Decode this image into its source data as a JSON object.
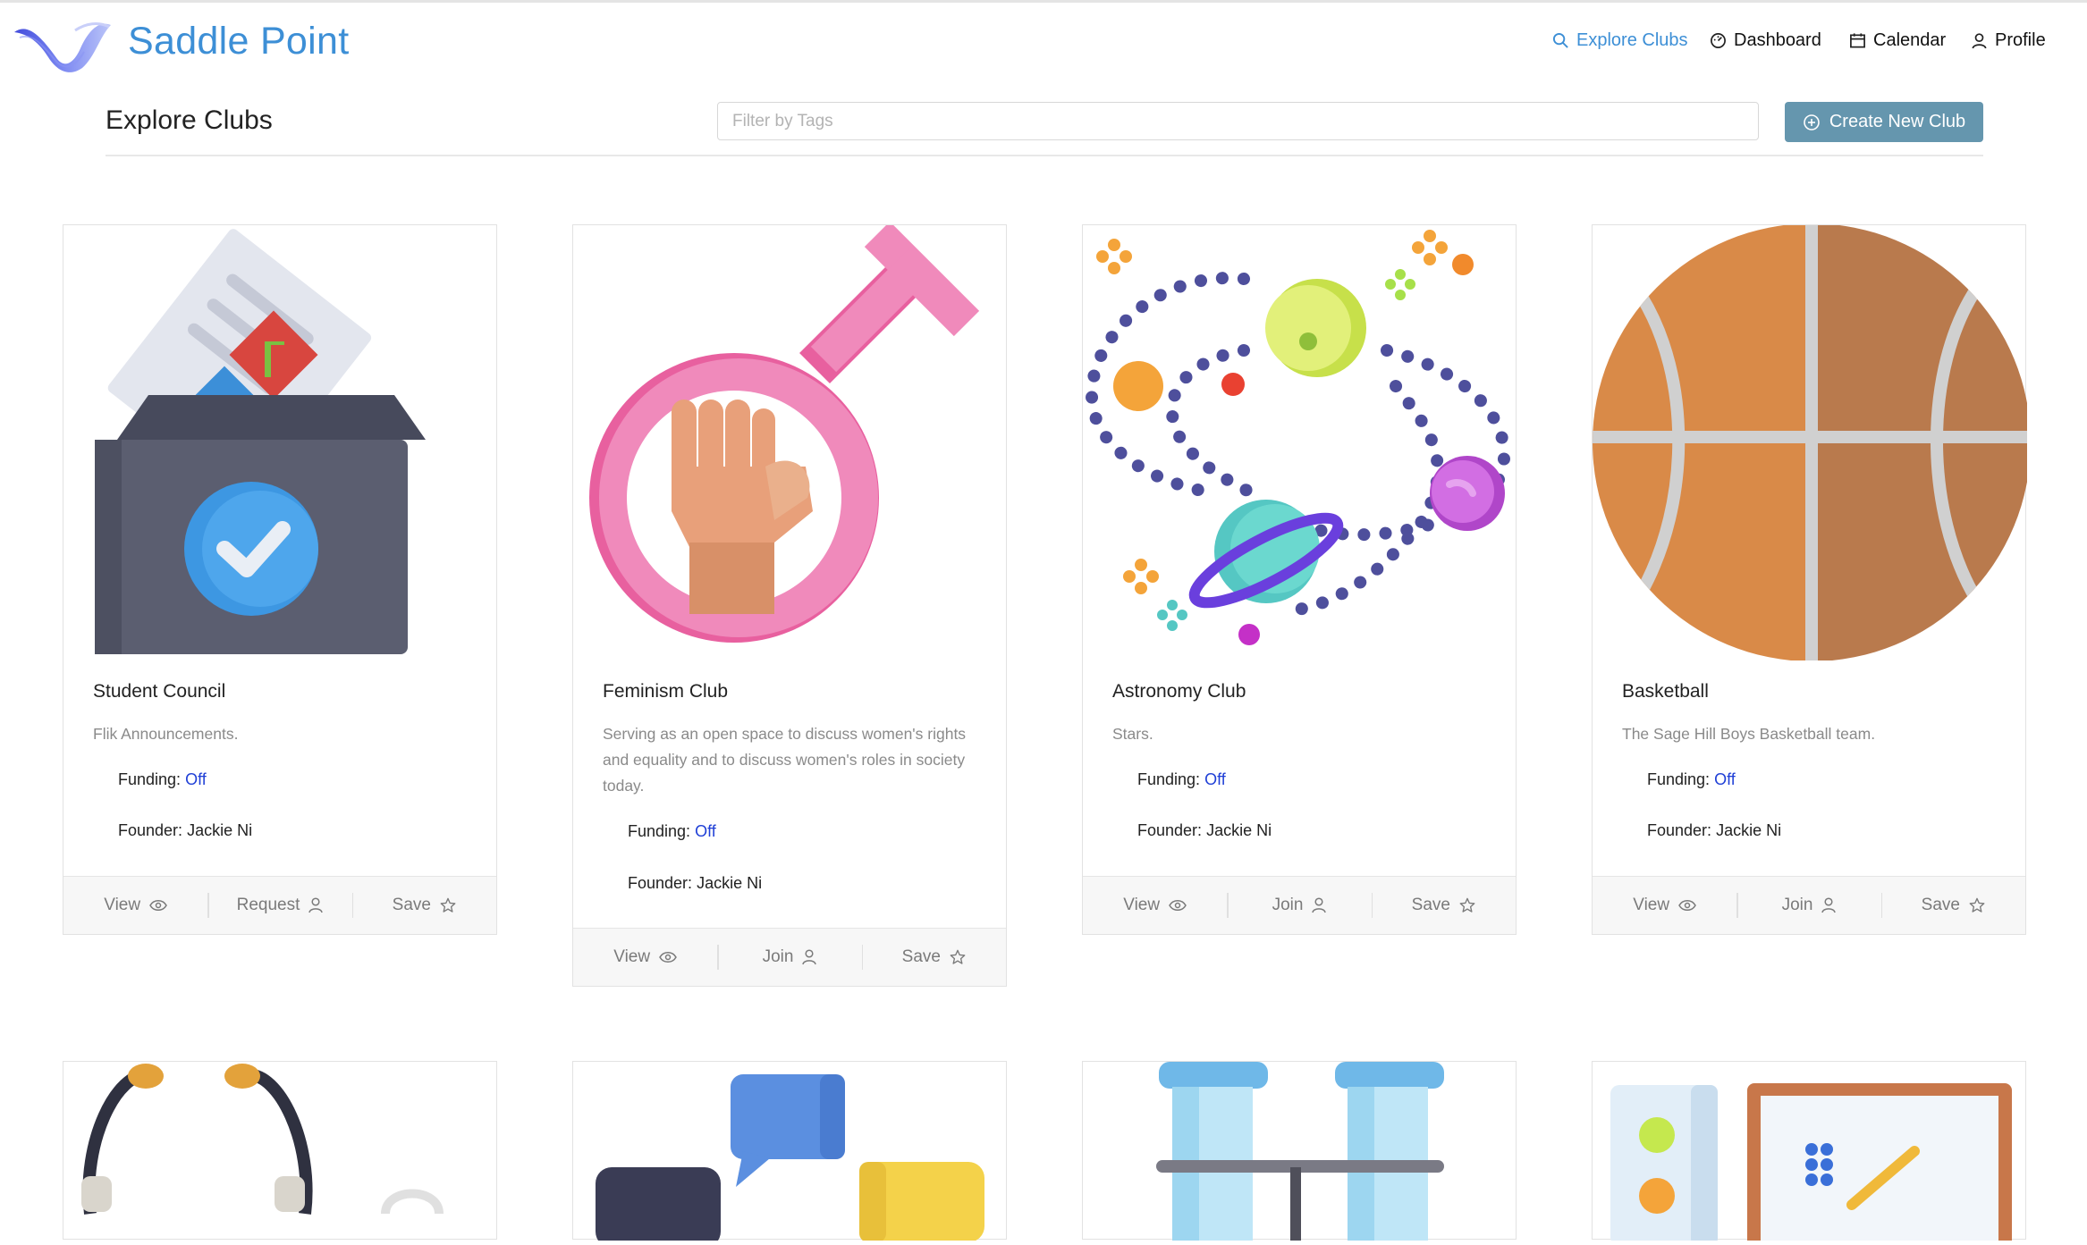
{
  "brand": {
    "name": "Saddle Point"
  },
  "nav": {
    "explore": "Explore Clubs",
    "dashboard": "Dashboard",
    "calendar": "Calendar",
    "profile": "Profile"
  },
  "page": {
    "title": "Explore Clubs",
    "filter_placeholder": "Filter by Tags",
    "create_label": "Create New Club"
  },
  "labels": {
    "funding": "Funding:",
    "founder": "Founder:"
  },
  "clubs": [
    {
      "name": "Student Council",
      "description": "Flik Announcements.",
      "funding": "Off",
      "founder": "Jackie Ni",
      "actions": [
        "View",
        "Request",
        "Save"
      ],
      "icon": "ballot-box-icon"
    },
    {
      "name": "Feminism Club",
      "description": "Serving as an open space to discuss women's rights and equality and to discuss women's roles in society today.",
      "funding": "Off",
      "founder": "Jackie Ni",
      "actions": [
        "View",
        "Join",
        "Save"
      ],
      "icon": "female-fist-icon"
    },
    {
      "name": "Astronomy Club",
      "description": "Stars.",
      "funding": "Off",
      "founder": "Jackie Ni",
      "actions": [
        "View",
        "Join",
        "Save"
      ],
      "icon": "solar-system-icon"
    },
    {
      "name": "Basketball",
      "description": "The Sage Hill Boys Basketball team.",
      "funding": "Off",
      "founder": "Jackie Ni",
      "actions": [
        "View",
        "Join",
        "Save"
      ],
      "icon": "basketball-icon"
    }
  ],
  "row2_icons": [
    "headphones-icon",
    "chat-bubbles-icon",
    "test-tubes-icon",
    "whiteboard-icon"
  ],
  "colors": {
    "brand_blue": "#3d8fd6",
    "button": "#6596ae",
    "funding_off": "#1f3fd6"
  }
}
